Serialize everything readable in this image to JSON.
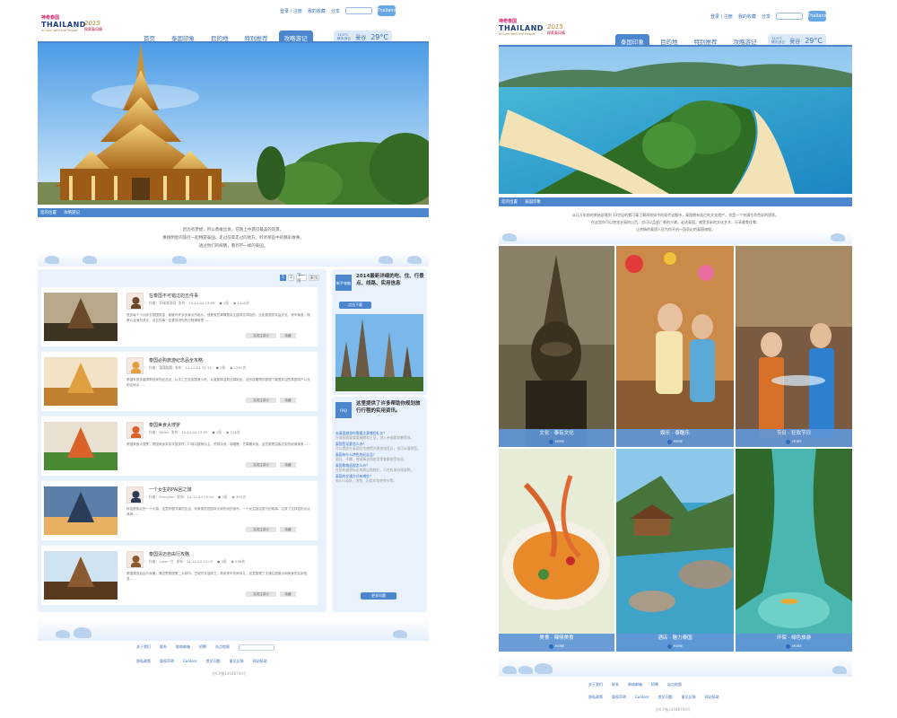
{
  "left": {
    "utility": {
      "login": "登录 / 注册",
      "favorite": "我的收藏",
      "share": "分享",
      "badge": "Thailand"
    },
    "logo": {
      "line1": "神奇泰国",
      "line2": "THAILAND",
      "line3": "In tune with the People"
    },
    "year": {
      "value": "2015",
      "sub": "探索泰风情"
    },
    "nav": [
      "首页",
      "泰国印象",
      "目的地",
      "特别推荐",
      "攻略游记"
    ],
    "weather": {
      "line1": "11/4°C",
      "line2": "晴天/多云",
      "city": "曼谷",
      "temp": "29°C"
    },
    "breadcrumb": [
      "您的位置",
      "攻略游记"
    ],
    "intro": [
      "因为有梦想，所以勇敢出发，在路上中遇见最美的风景。",
      "惠顾明星的旅行一起畅游泰国，走过前辈走过的地方，聆听那些中的精彩故事，",
      "透过他们的眼睛，看到不一样的泰国。"
    ],
    "pager": [
      "1",
      "2",
      "下一页",
      "末页"
    ],
    "articles": [
      {
        "title": "在泰国不可错过的五件事",
        "author": "作者：环球旅游网",
        "date": "发布：14-12-04 13:06",
        "comments": "3条",
        "views": "1240次",
        "excerpt": "很多每个小伙伴去泰国旅游，都被许许多多景点所吸引，但是有些事情是真正值得去体验的，比如泰国的寺庙文化，夜市美食，按摩以及海岛风光，这五件事一定要放进你的行程清单里……",
        "btn1": "加关注游记",
        "btn2": "收藏"
      },
      {
        "title": "泰国必购旅游纪念品全攻略",
        "author": "作者：蒲蒲聪聪",
        "date": "发布：14-12-04 13:14",
        "comments": "2条",
        "views": "1291次",
        "excerpt": "泰国有很多值得带回家的纪念品，从手工艺品到零食小吃，从香薰精油到丝绸制品，这份攻略帮你整理了最受欢迎的泰国特产以及购买地点……",
        "btn1": "加关注游记",
        "btn2": "收藏"
      },
      {
        "title": "泰国美食大搜罗",
        "author": "作者：Helen",
        "date": "发布：14-12-04 13:05",
        "comments": "3条",
        "views": "314次",
        "excerpt": "泰国美食大搜罗，泰国美食菜系丰富多样，口味以酸辣为主，冬阴功汤，咖喱蟹，芒果糯米饭，这些都是游客必尝的经典美食……",
        "btn1": "加关注游记",
        "btn2": "收藏"
      },
      {
        "title": "一个女生的PAI回之旅",
        "author": "作者：Fennyfen",
        "date": "发布：14-12-04 13:04",
        "comments": "3条",
        "views": "305次",
        "excerpt": "拜县是泰北的一个小镇，这里有慢节奏的生活，有美丽的田园风光和热闹的夜市，一个女生独自旅行的故事，记录了在拜县的点点滴滴……",
        "btn1": "加关注游记",
        "btn2": "收藏"
      },
      {
        "title": "泰国清迈自由行攻略",
        "author": "作者：Love一生",
        "date": "发布：14-12-04 13:03",
        "comments": "3条",
        "views": "436次",
        "excerpt": "泰国清迈自由行攻略，清迈是泰国第二大城市，古城内寺庙林立，周末夜市热闹非凡，这里整理了交通住宿景点和美食的实用信息……",
        "btn1": "加关注游记",
        "btn2": "收藏"
      }
    ],
    "side1": {
      "tag": "新手攻略",
      "heading": "2014最新详细的吃、住、行景点、线路、实用信息",
      "btn": "点击下载"
    },
    "side2": {
      "tag": "FAQ",
      "heading": "这里提供了许多帮助你规划旅行行程的实用资讯。",
      "more": "更多问题"
    },
    "faq": [
      {
        "q": "去泰国旅游时需要注意哪些礼仪？",
        "a": "在泰国需要尊重佛教和王室，进入寺庙要穿着得体。"
      },
      {
        "q": "泰国签证要怎么办？",
        "a": "可以提前在泰国驻华使馆办理旅游签证，也可以落地签。"
      },
      {
        "q": "泰国有什么特色的纪念品？",
        "a": "泰丝、木雕、香薰精油和各类零食都很受欢迎。"
      },
      {
        "q": "泰国购物退税怎么办？",
        "a": "在贴有退税标志的商店购物后，可在机场办理退税。"
      },
      {
        "q": "泰国的交通方式有哪些？",
        "a": "有BTS轻轨、地铁、出租车和突突车等。"
      }
    ],
    "footer": [
      "关于我们",
      "联系",
      "联络邮箱",
      "招聘",
      "站点地图"
    ],
    "footer2": [
      "隐私政策",
      "版权声明",
      "Cookies",
      "常见问题",
      "意见反馈",
      "网站帮助"
    ],
    "copyright": "京ICP备14048796号"
  },
  "right": {
    "utility": {
      "login": "登录 / 注册",
      "favorite": "我的收藏",
      "share": "分享",
      "badge": "Thailand"
    },
    "logo": {
      "line1": "神奇泰国",
      "line2": "THAILAND",
      "line3": "In tune with the People"
    },
    "year": {
      "value": "2015",
      "sub": "探索泰风情"
    },
    "nav": [
      "泰国印象",
      "目的地",
      "特别推荐",
      "攻略游记"
    ],
    "weather": {
      "line1": "11/4°C",
      "line2": "晴天/多云",
      "city": "曼谷",
      "temp": "29°C"
    },
    "breadcrumb": [
      "您的位置",
      "泰国印象"
    ],
    "intro": [
      "从几万年前的原始部落到 13世纪的素可泰王朝再到如今的现代化都市，泰国拥有灿烂的文化遗产，也是一个充满生命色彩的国家。",
      "在这里你可以饱览壮丽的山峦，也可以品尝广袤的沙滩，走进泰国，感受多彩的文化艺术，乐享美食佳肴，",
      "让热情的泰国人民为你开启一段奇幻的泰国旅程。"
    ],
    "tiles": [
      {
        "label": "文化 · 泰有文化",
        "more": "MORE"
      },
      {
        "label": "娱乐 · 泰酷乐",
        "more": "MORE"
      },
      {
        "label": "节日 · 狂欢节日",
        "more": "MORE"
      },
      {
        "label": "美食 · 辣够美食",
        "more": "MORE"
      },
      {
        "label": "酒店 · 魅力泰国",
        "more": "MORE"
      },
      {
        "label": "环保 · 绿色旅游",
        "more": "MORE"
      }
    ],
    "footer": [
      "关于我们",
      "联系",
      "联络邮箱",
      "招聘",
      "站点地图"
    ],
    "footer2": [
      "隐私政策",
      "版权声明",
      "Cookies",
      "常见问题",
      "意见反馈",
      "网站帮助"
    ],
    "copyright": "京ICP备14048796号"
  }
}
